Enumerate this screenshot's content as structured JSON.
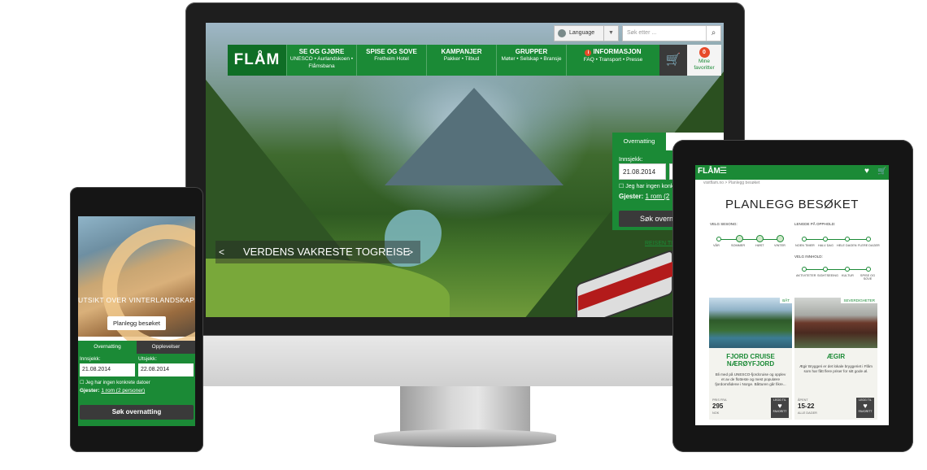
{
  "monitor": {
    "language_label": "Language",
    "search_placeholder": "Søk etter ...",
    "logo": "FLÅM",
    "nav": [
      {
        "title": "SE OG GJØRE",
        "sub1": "UNESCO • Aurlandskoen •",
        "sub2": "Flåmsbana"
      },
      {
        "title": "SPISE OG SOVE",
        "sub1": "Fretheim Hotel",
        "sub2": ""
      },
      {
        "title": "KAMPANJER",
        "sub1": "Pakker • Tilbud",
        "sub2": ""
      },
      {
        "title": "GRUPPER",
        "sub1": "Møter • Selskap • Bransje",
        "sub2": ""
      },
      {
        "title": "INFORMASJON",
        "sub1": "FAQ • Transport • Presse",
        "sub2": ""
      }
    ],
    "info_icon": "i",
    "favorites_count": "0",
    "favorites_label_1": "Mine",
    "favorites_label_2": "favoritter",
    "hero_caption": "VERDENS VAKRESTE TOGREISE",
    "caption_prev": "<",
    "caption_next": ">",
    "booking": {
      "tab": "Overnatting",
      "checkin_label": "Innsjekk:",
      "checkin_value": "21.08.2014",
      "no_dates_label": "Jeg har ingen konk",
      "guests_label": "Gjester:",
      "guests_value": "1 rom (2",
      "search_button": "Søk overn",
      "below_link": "REISEN TIL"
    }
  },
  "phone": {
    "hero_text": "UTSIKT OVER VINTERLANDSKAPET",
    "hero_button": "Planlegg besøket",
    "tab_1": "Overnatting",
    "tab_2": "Opplevelser",
    "checkin_label": "Innsjekk:",
    "checkout_label": "Utsjekk:",
    "checkin_value": "21.08.2014",
    "checkout_value": "22.08.2014",
    "no_dates_label": "Jeg har ingen konkrete datoer",
    "guests_label": "Gjester:",
    "guests_value": "1 rom (2 personer)",
    "search_button": "Søk overnatting"
  },
  "tablet": {
    "logo": "FLÅM",
    "breadcrumb": "visitflam.no  >  Planlegg besøket",
    "title": "PLANLEGG BESØKET",
    "season_label": "VELG SESONG:",
    "seasons": [
      "VÅR",
      "SOMMER",
      "HØST",
      "VINTER"
    ],
    "stay_label": "LENGDE PÅ OPPHOLD:",
    "stays": [
      "NOEN TIMER",
      "HALV DAG",
      "HELE DAGEN",
      "FLERE DAGER"
    ],
    "content_label": "VELG INNHOLD:",
    "contents": [
      "AKTIVITETER",
      "SIGHTSEEING",
      "KULTUR",
      "SPISE OG SOVE"
    ],
    "cards": [
      {
        "tag": "BÅT",
        "title_1": "FJORD CRUISE",
        "title_2": "NÆRØYFJORD",
        "text": "Bli med på UNESCO-fjordcruise og opplev et av de flotteste og mest populære fjordområdene i Norge. Båtturen går fikre...",
        "price_label": "PRIS FRA",
        "price": "295",
        "price_unit": "NOK",
        "fav_1": "LEGG TIL",
        "fav_2": "FAVORITT"
      },
      {
        "tag": "SEVERDIGHETER",
        "title_1": "ÆGIR",
        "title_2": "",
        "text": "Ægir Bryggeri er det lokale bryggeriet i Flåm som har fått flere priser for sitt gode øl.",
        "price_label": "ÅPENT",
        "price": "15-22",
        "price_unit": "ALLE DAGER",
        "fav_1": "LEGG TIL",
        "fav_2": "FAVORITT"
      }
    ]
  },
  "colors": {
    "brand_green": "#1b8a36",
    "dark": "#3a3a3a",
    "accent_red": "#e74a2a"
  }
}
